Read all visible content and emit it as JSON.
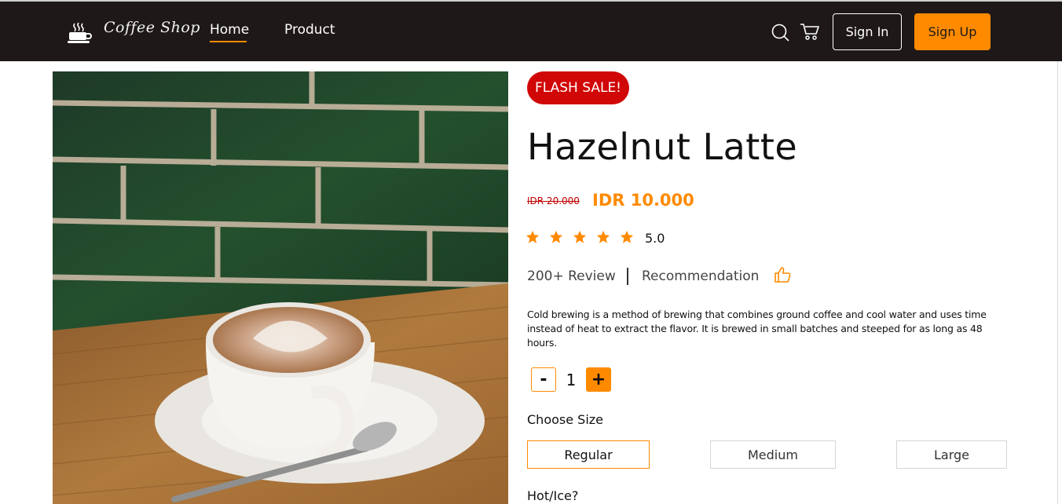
{
  "header": {
    "brand": "Coffee Shop",
    "nav": [
      {
        "label": "Home",
        "active": true
      },
      {
        "label": "Product",
        "active": false
      }
    ],
    "icons": [
      "search-icon",
      "cart-icon"
    ],
    "sign_in": "Sign In",
    "sign_up": "Sign Up"
  },
  "product": {
    "badge": "FLASH SALE!",
    "title": "Hazelnut Latte",
    "old_price": "IDR 20.000",
    "new_price": "IDR 10.000",
    "stars": 5,
    "rating": "5.0",
    "review": "200+ Review",
    "recommendation": "Recommendation",
    "description": "Cold brewing is a method of brewing that combines ground coffee and cool water and uses time instead of heat to extract the flavor. It is brewed in small batches and steeped for as long as 48 hours.",
    "image_alt": "latte art coffee cup on saucer with spoon on wooden table"
  },
  "quantity": {
    "minus": "-",
    "value": "1",
    "plus": "+"
  },
  "size": {
    "label": "Choose Size",
    "options": [
      "Regular",
      "Medium",
      "Large"
    ],
    "selected": "Regular"
  },
  "temperature": {
    "label": "Hot/Ice?"
  },
  "colors": {
    "accent": "#ff8a00",
    "nav_bg": "#1e1918",
    "badge": "#d10606"
  }
}
